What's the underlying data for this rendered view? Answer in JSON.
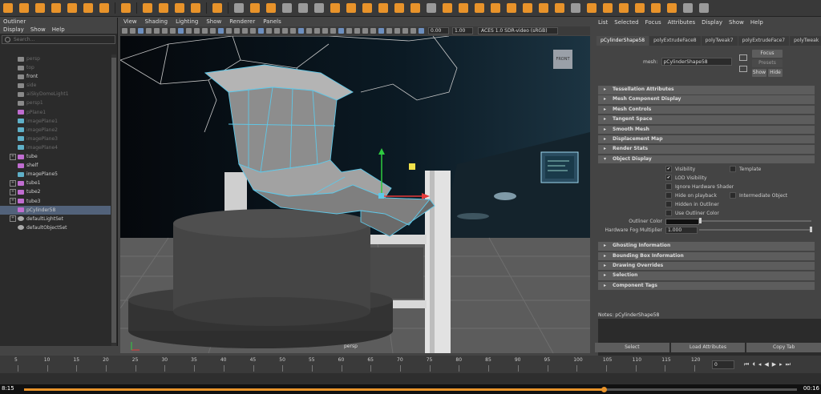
{
  "outliner": {
    "title": "Outliner",
    "menu": [
      "Display",
      "Show",
      "Help"
    ],
    "search_placeholder": "Search...",
    "items": [
      {
        "label": "persp",
        "kind": "camera",
        "hidden": true,
        "expandable": false,
        "selected": false
      },
      {
        "label": "top",
        "kind": "camera",
        "hidden": true,
        "expandable": false,
        "selected": false
      },
      {
        "label": "front",
        "kind": "camera",
        "hidden": false,
        "expandable": false,
        "selected": false
      },
      {
        "label": "side",
        "kind": "camera",
        "hidden": true,
        "expandable": false,
        "selected": false
      },
      {
        "label": "aiSkyDomeLight1",
        "kind": "light",
        "hidden": true,
        "expandable": false,
        "selected": false
      },
      {
        "label": "persp1",
        "kind": "camera",
        "hidden": true,
        "expandable": false,
        "selected": false
      },
      {
        "label": "pPlane1",
        "kind": "geo",
        "hidden": true,
        "expandable": false,
        "selected": false
      },
      {
        "label": "imagePlane1",
        "kind": "img",
        "hidden": true,
        "expandable": false,
        "selected": false
      },
      {
        "label": "imagePlane2",
        "kind": "img",
        "hidden": true,
        "expandable": false,
        "selected": false
      },
      {
        "label": "imagePlane3",
        "kind": "img",
        "hidden": true,
        "expandable": false,
        "selected": false
      },
      {
        "label": "imagePlane4",
        "kind": "img",
        "hidden": true,
        "expandable": false,
        "selected": false
      },
      {
        "label": "tube",
        "kind": "geo",
        "hidden": false,
        "expandable": true,
        "selected": false
      },
      {
        "label": "shelf",
        "kind": "geo",
        "hidden": false,
        "expandable": false,
        "selected": false
      },
      {
        "label": "imagePlane5",
        "kind": "img",
        "hidden": false,
        "expandable": false,
        "selected": false
      },
      {
        "label": "tube1",
        "kind": "geo",
        "hidden": false,
        "expandable": true,
        "selected": false
      },
      {
        "label": "tube2",
        "kind": "geo",
        "hidden": false,
        "expandable": true,
        "selected": false
      },
      {
        "label": "tube3",
        "kind": "geo",
        "hidden": false,
        "expandable": true,
        "selected": false
      },
      {
        "label": "pCylinder58",
        "kind": "geo",
        "hidden": false,
        "expandable": false,
        "selected": true
      },
      {
        "label": "defaultLightSet",
        "kind": "set",
        "hidden": false,
        "expandable": true,
        "selected": false
      },
      {
        "label": "defaultObjectSet",
        "kind": "set",
        "hidden": false,
        "expandable": false,
        "selected": false
      }
    ]
  },
  "viewport": {
    "menu": [
      "View",
      "Shading",
      "Lighting",
      "Show",
      "Renderer",
      "Panels"
    ],
    "exposure": "0.00",
    "gamma": "1.00",
    "color_management": "ACES 1.0 SDR-video (sRGB)",
    "camera_label": "persp",
    "view_cube_label": "FRONT"
  },
  "attribute_editor": {
    "menu": [
      "List",
      "Selected",
      "Focus",
      "Attributes",
      "Display",
      "Show",
      "Help"
    ],
    "tabs": [
      "pCylinderShape58",
      "polyExtrudeFace8",
      "polyTweak7",
      "polyExtrudeFace7",
      "polyTweak"
    ],
    "mesh_label": "mesh:",
    "mesh_value": "pCylinderShape58",
    "focus_button": "Focus",
    "presets_button": "Presets",
    "show_button": "Show",
    "hide_button": "Hide",
    "sections_top": [
      "Tessellation Attributes",
      "Mesh Component Display",
      "Mesh Controls",
      "Tangent Space",
      "Smooth Mesh",
      "Displacement Map",
      "Render Stats"
    ],
    "object_display_title": "Object Display",
    "checkboxes": {
      "visibility": {
        "label": "Visibility",
        "checked": true
      },
      "template": {
        "label": "Template",
        "checked": false
      },
      "lod_visibility": {
        "label": "LOD Visibility",
        "checked": true
      },
      "ignore_hw_shader": {
        "label": "Ignore Hardware Shader",
        "checked": false
      },
      "hide_on_playback": {
        "label": "Hide on playback",
        "checked": false
      },
      "intermediate_object": {
        "label": "Intermediate Object",
        "checked": false
      },
      "hidden_in_outliner": {
        "label": "Hidden in Outliner",
        "checked": false
      },
      "use_outliner_color": {
        "label": "Use Outliner Color",
        "checked": false
      }
    },
    "outliner_color_label": "Outliner Color",
    "hw_fog_label": "Hardware Fog Multiplier",
    "hw_fog_value": "1.000",
    "sections_bottom": [
      "Ghosting Information",
      "Bounding Box Information",
      "Drawing Overrides",
      "Selection",
      "Component Tags"
    ],
    "notes_label": "Notes: pCylinderShape58",
    "bottom_buttons": [
      "Select",
      "Load Attributes",
      "Copy Tab"
    ]
  },
  "timeline": {
    "ticks": [
      5,
      10,
      15,
      20,
      25,
      30,
      35,
      40,
      45,
      50,
      55,
      60,
      65,
      70,
      75,
      80,
      85,
      90,
      95,
      100,
      105,
      110,
      115,
      120
    ],
    "current_frame": "0"
  },
  "player": {
    "elapsed": "8:15",
    "remaining": "00:16",
    "progress": 0.75
  },
  "colors": {
    "accent": "#e8932a",
    "selection": "#52627a",
    "wireframe": "#5fc8e8"
  }
}
